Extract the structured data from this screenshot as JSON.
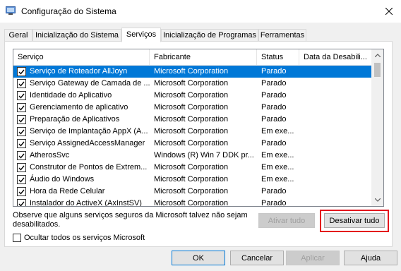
{
  "window": {
    "title": "Configuração do Sistema",
    "icon": "system-config-icon",
    "close_icon": "close-icon"
  },
  "tabs": [
    {
      "label": "Geral",
      "active": false
    },
    {
      "label": "Inicialização do Sistema",
      "active": false
    },
    {
      "label": "Serviços",
      "active": true
    },
    {
      "label": "Inicialização de Programas",
      "active": false
    },
    {
      "label": "Ferramentas",
      "active": false
    }
  ],
  "services_table": {
    "columns": [
      "Serviço",
      "Fabricante",
      "Status",
      "Data da Desabili..."
    ],
    "rows": [
      {
        "checked": true,
        "service": "Serviço de Roteador AllJoyn",
        "manufacturer": "Microsoft Corporation",
        "status": "Parado",
        "date": "",
        "selected": true
      },
      {
        "checked": true,
        "service": "Serviço Gateway de Camada de ...",
        "manufacturer": "Microsoft Corporation",
        "status": "Parado",
        "date": ""
      },
      {
        "checked": true,
        "service": "Identidade do Aplicativo",
        "manufacturer": "Microsoft Corporation",
        "status": "Parado",
        "date": ""
      },
      {
        "checked": true,
        "service": "Gerenciamento de aplicativo",
        "manufacturer": "Microsoft Corporation",
        "status": "Parado",
        "date": ""
      },
      {
        "checked": true,
        "service": "Preparação de Aplicativos",
        "manufacturer": "Microsoft Corporation",
        "status": "Parado",
        "date": ""
      },
      {
        "checked": true,
        "service": "Serviço de Implantação AppX (A...",
        "manufacturer": "Microsoft Corporation",
        "status": "Em exe...",
        "date": ""
      },
      {
        "checked": true,
        "service": "Serviço AssignedAccessManager",
        "manufacturer": "Microsoft Corporation",
        "status": "Parado",
        "date": ""
      },
      {
        "checked": true,
        "service": "AtherosSvc",
        "manufacturer": "Windows (R) Win 7 DDK pr...",
        "status": "Em exe...",
        "date": ""
      },
      {
        "checked": true,
        "service": "Construtor de Pontos de Extrem...",
        "manufacturer": "Microsoft Corporation",
        "status": "Em exe...",
        "date": ""
      },
      {
        "checked": true,
        "service": "Áudio do Windows",
        "manufacturer": "Microsoft Corporation",
        "status": "Em exe...",
        "date": ""
      },
      {
        "checked": true,
        "service": "Hora da Rede Celular",
        "manufacturer": "Microsoft Corporation",
        "status": "Parado",
        "date": ""
      },
      {
        "checked": true,
        "service": "Instalador do ActiveX (AxInstSV)",
        "manufacturer": "Microsoft Corporation",
        "status": "Parado",
        "date": ""
      }
    ]
  },
  "note": "Observe que alguns serviços seguros da Microsoft talvez não sejam desabilitados.",
  "buttons": {
    "enable_all": "Ativar tudo",
    "disable_all": "Desativar tudo",
    "ok": "OK",
    "cancel": "Cancelar",
    "apply": "Aplicar",
    "help": "Ajuda"
  },
  "hide_ms_services": {
    "label": "Ocultar todos os serviços Microsoft",
    "checked": false
  },
  "colors": {
    "selection": "#0078d7",
    "highlight_border": "#e3141c"
  }
}
